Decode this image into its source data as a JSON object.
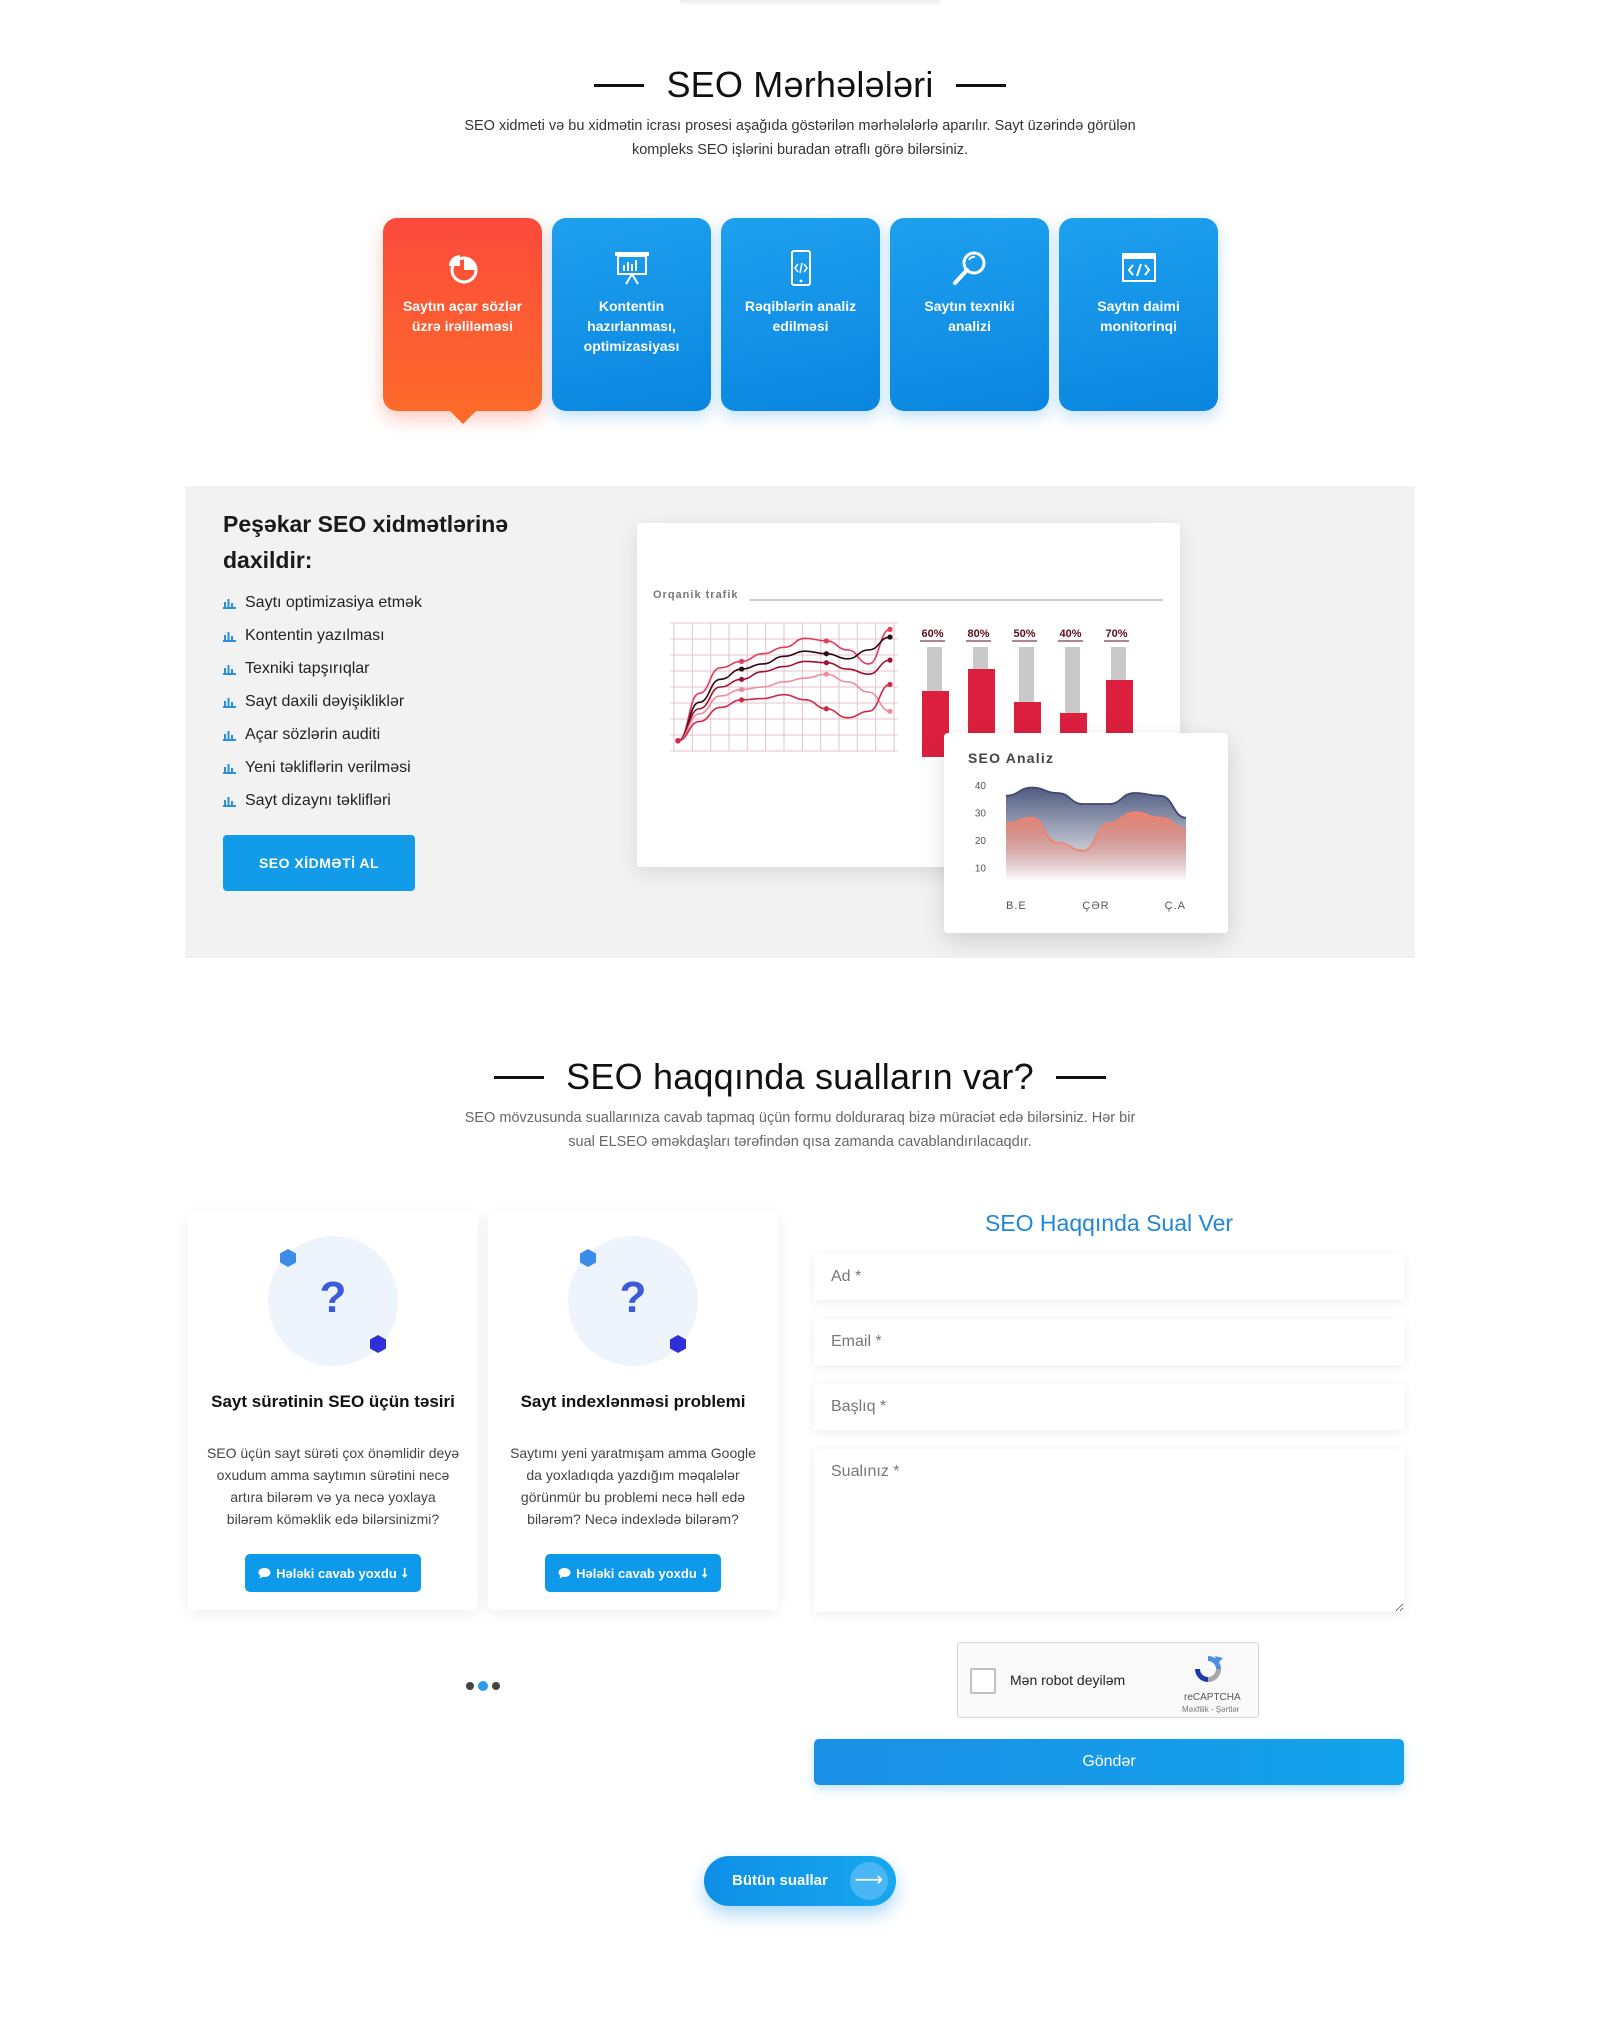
{
  "stages_section": {
    "title": "SEO Mərhələləri",
    "subtitle": "SEO xidmeti və bu xidmətin icrası prosesi aşağıda göstərilən mərhələlərlə aparılır. Sayt üzərində görülən kompleks SEO işlərini buradan ətraflı görə bilərsiniz.",
    "stages": [
      {
        "label": "Saytın açar sözlər üzrə irəliləməsi",
        "icon": "pie-chart-icon",
        "active": true
      },
      {
        "label": "Kontentin hazırlanması, optimizasiyası",
        "icon": "presentation-board-icon",
        "active": false
      },
      {
        "label": "Rəqiblərin analiz edilməsi",
        "icon": "mobile-code-icon",
        "active": false
      },
      {
        "label": "Saytın texniki analizi",
        "icon": "magnifier-icon",
        "active": false
      },
      {
        "label": "Saytın daimi monitorinqi",
        "icon": "browser-code-icon",
        "active": false
      }
    ]
  },
  "services": {
    "title": "Peşəkar SEO xidmətlərinə daxildir:",
    "items": [
      "Saytı optimizasiya etmək",
      "Kontentin yazılması",
      "Texniki tapşırıqlar",
      "Sayt daxili dəyişikliklər",
      "Açar sözlərin auditi",
      "Yeni təkliflərin verilməsi",
      "Sayt dizaynı təklifləri"
    ],
    "button_label": "SEO XİDMƏTİ AL",
    "bullet_icon": "bar-chart-icon"
  },
  "chart_data": [
    {
      "type": "line",
      "title": "Orqanik trafik",
      "x": [
        1,
        2,
        3,
        4,
        5,
        6,
        7,
        8,
        9,
        10,
        11
      ],
      "ylim": [
        0,
        10
      ],
      "series": [
        {
          "values": [
            0.8,
            4.5,
            6.5,
            7.0,
            7.6,
            8.1,
            8.8,
            8.6,
            7.9,
            6.8,
            9.5
          ]
        },
        {
          "values": [
            0.8,
            3.8,
            5.6,
            6.4,
            6.8,
            7.4,
            7.8,
            7.6,
            7.2,
            7.9,
            8.9
          ]
        },
        {
          "values": [
            0.8,
            3.3,
            5.0,
            5.6,
            6.2,
            6.6,
            7.0,
            6.9,
            6.4,
            6.0,
            7.1
          ]
        },
        {
          "values": [
            0.8,
            2.9,
            4.3,
            4.8,
            5.0,
            5.4,
            5.7,
            6.0,
            5.4,
            4.6,
            3.1
          ]
        },
        {
          "values": [
            0.8,
            2.3,
            3.4,
            4.0,
            4.1,
            4.4,
            4.0,
            3.3,
            2.6,
            3.1,
            5.2
          ]
        }
      ],
      "colors": [
        "#e83a5a",
        "#2b0a14",
        "#a3112e",
        "#f08a9c",
        "#d12945"
      ]
    },
    {
      "type": "bar",
      "categories": [
        "60%",
        "80%",
        "50%",
        "40%",
        "70%"
      ],
      "values": [
        60,
        80,
        50,
        40,
        70
      ],
      "ylim": [
        0,
        100
      ],
      "colors": {
        "filled": "#dc1f3f",
        "track": "#c9c9c9"
      }
    },
    {
      "type": "area",
      "title": "SEO Analiz",
      "categories": [
        "B.E",
        "ÇƏR",
        "Ç.A"
      ],
      "y_ticks": [
        40,
        30,
        20,
        10
      ],
      "ylim": [
        5,
        45
      ],
      "series": [
        {
          "values": [
            36,
            39,
            37,
            33,
            33,
            37,
            36,
            28
          ],
          "color": "#3d4a73"
        },
        {
          "values": [
            26,
            28,
            19,
            16,
            26,
            30,
            28,
            24
          ],
          "color": "#f0836f"
        }
      ]
    }
  ],
  "questions_section": {
    "title": "SEO haqqında sualların var?",
    "subtitle": "SEO mövzusunda suallarınıza cavab tapmaq üçün formu dolduraraq bizə müraciət edə bilərsiniz. Hər bir sual ELSEO əməkdaşları tərəfindən qısa zamanda cavablandırılacaqdır."
  },
  "faq_cards": [
    {
      "icon": "question-mark-icon",
      "title": "Sayt sürətinin SEO üçün təsiri",
      "text": "SEO üçün sayt sürəti çox önəmlidir deyə oxudum amma saytımın sürətini necə artıra bilərəm və ya necə yoxlaya bilərəm köməklik edə bilərsinizmi?",
      "button_label": "Hələki cavab yoxdu"
    },
    {
      "icon": "question-mark-icon",
      "title": "Sayt indexlənməsi problemi",
      "text": "Saytımı yeni yaratmışam amma Google da yoxladıqda yazdığım məqalələr görünmür bu problemi necə həll edə bilərəm? Necə indexlədə bilərəm?",
      "button_label": "Hələki cavab yoxdu"
    }
  ],
  "form": {
    "title": "SEO Haqqında Sual Ver",
    "name_placeholder": "Ad *",
    "email_placeholder": "Email *",
    "subject_placeholder": "Başlıq *",
    "question_placeholder": "Sualınız *",
    "captcha_label": "Mən robot deyiləm",
    "captcha_brand": "reCAPTCHA",
    "captcha_terms": "Məxfilik - Şərtlər",
    "submit_label": "Göndər"
  },
  "all_questions_button": "Bütün suallar",
  "colors": {
    "primary_blue": "#0d9aea",
    "active_orange": "#fb4a3c",
    "chart_red": "#dc1f3f",
    "form_title_blue": "#1f87d6"
  }
}
